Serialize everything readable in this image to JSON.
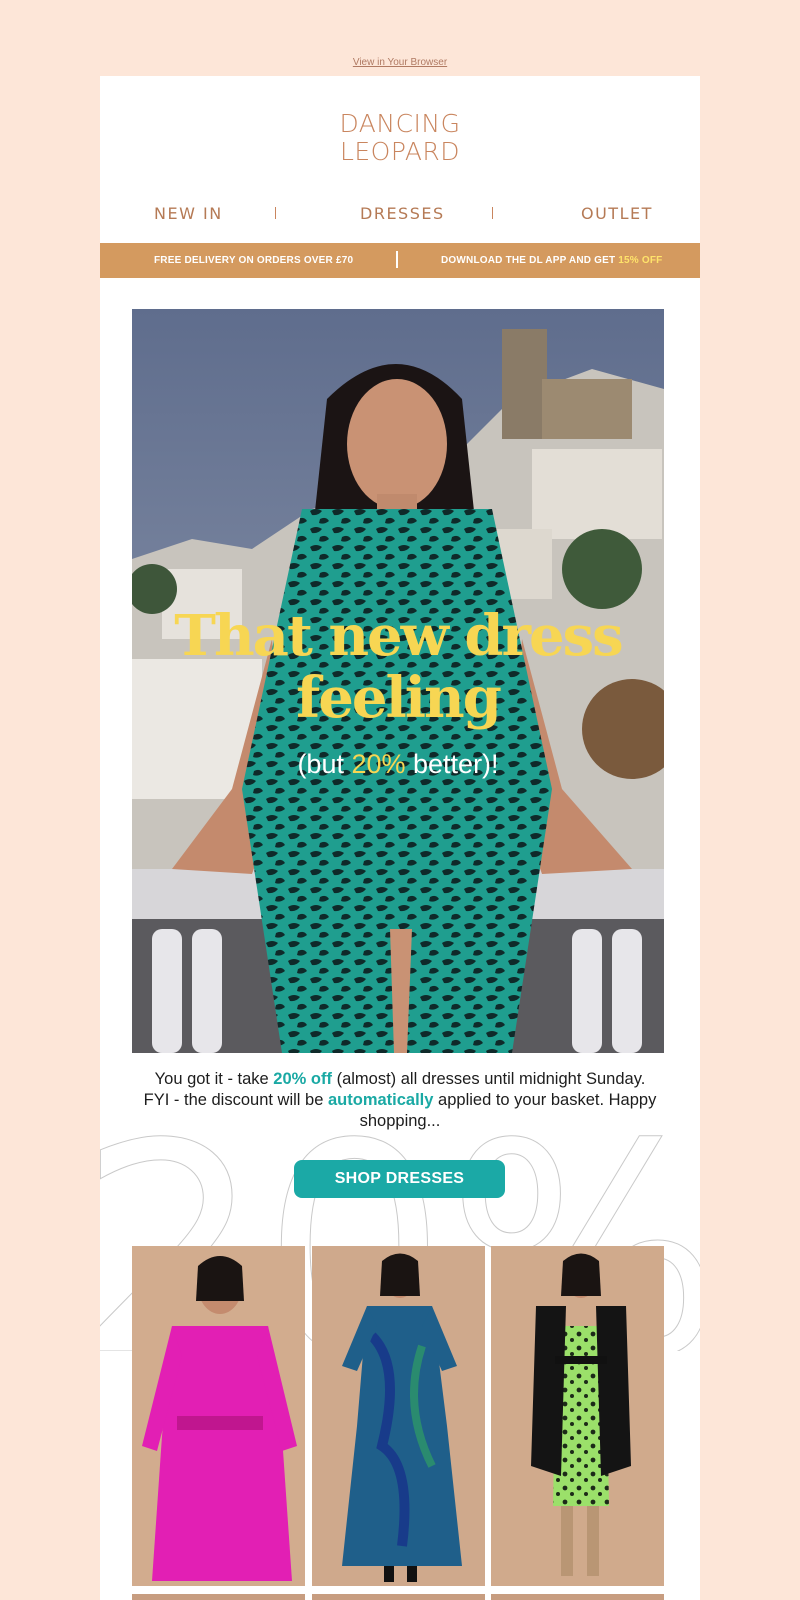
{
  "header": {
    "view_in_browser": "View in Your Browser"
  },
  "brand": {
    "line1": "DANCING",
    "line2": "LEOPARD",
    "color": "#c9855e"
  },
  "nav": {
    "items": [
      {
        "label": "NEW IN"
      },
      {
        "label": "DRESSES"
      },
      {
        "label": "OUTLET"
      }
    ]
  },
  "promo_bar": {
    "left": "FREE DELIVERY ON ORDERS OVER £70",
    "right_prefix": "DOWNLOAD THE DL APP AND GET ",
    "right_highlight": "15% OFF",
    "background": "#d49a5f",
    "highlight_color": "#ffe36a"
  },
  "hero": {
    "title_line1": "That new dress",
    "title_line2": "feeling",
    "sub_prefix": "(but ",
    "sub_highlight": "20%",
    "sub_suffix": " better)!",
    "title_color": "#f7d653"
  },
  "message": {
    "p1": "You got it - take ",
    "h1": "20% off",
    "p2": " (almost) all dresses until midnight Sunday. FYI - the discount will be ",
    "h2": "automatically",
    "p3": " applied to your basket. Happy shopping...",
    "accent": "#1aa9a4"
  },
  "cta": {
    "label": "SHOP DRESSES",
    "color": "#1ba9a6"
  },
  "decor": {
    "numerals": "20%"
  },
  "products": [
    {
      "icon": "pink-shirt-dress-photo",
      "color": "#e21fb4"
    },
    {
      "icon": "blue-wrap-dress-photo",
      "color": "#1f5f8a"
    },
    {
      "icon": "green-leopard-dress-photo",
      "color": "#9be06a"
    }
  ]
}
